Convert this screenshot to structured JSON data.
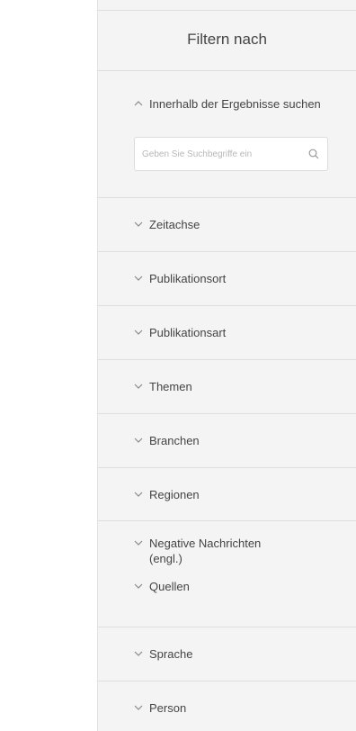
{
  "filter_panel": {
    "title": "Filtern nach",
    "search_section": {
      "label": "Innerhalb der Ergebnisse suchen",
      "placeholder": "Geben Sie Suchbegriffe ein"
    },
    "facets": [
      {
        "label": "Zeitachse"
      },
      {
        "label": "Publikationsort"
      },
      {
        "label": "Publikationsart"
      },
      {
        "label": "Themen"
      },
      {
        "label": "Branchen"
      },
      {
        "label": "Regionen"
      },
      {
        "label": "Negative Nachrichten (engl.)"
      },
      {
        "label": "Quellen"
      },
      {
        "label": "Sprache"
      },
      {
        "label": "Person"
      }
    ]
  }
}
